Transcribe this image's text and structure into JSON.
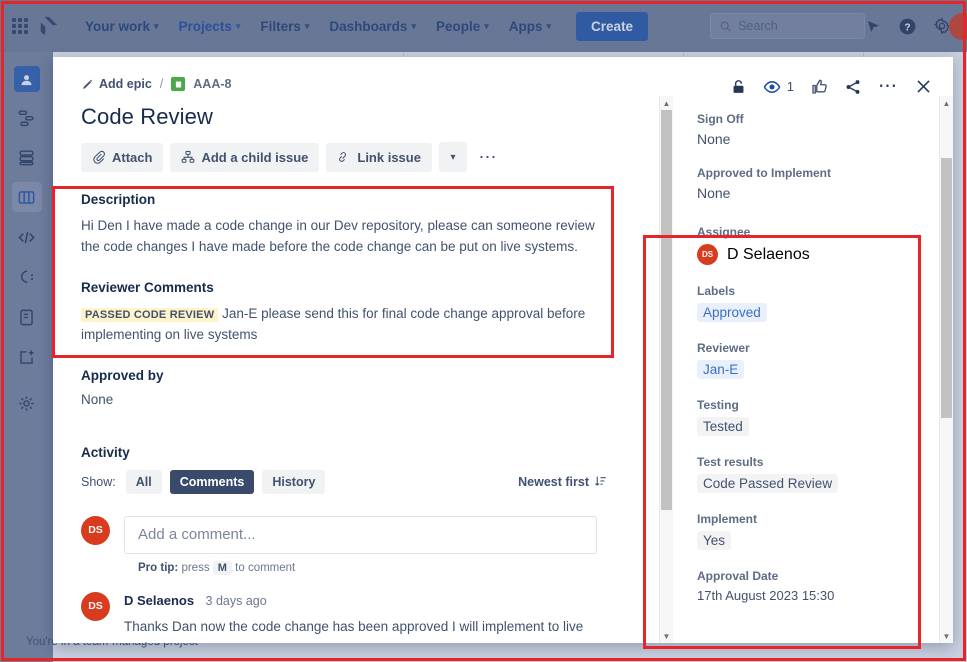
{
  "topnav": {
    "apps_grid_icon": "grid-icon",
    "product_logo_icon": "jira-logo-icon",
    "items": [
      {
        "label": "Your work",
        "has_caret": true,
        "active": false
      },
      {
        "label": "Projects",
        "has_caret": true,
        "active": true
      },
      {
        "label": "Filters",
        "has_caret": true,
        "active": false
      },
      {
        "label": "Dashboards",
        "has_caret": true,
        "active": false
      },
      {
        "label": "People",
        "has_caret": true,
        "active": false
      },
      {
        "label": "Apps",
        "has_caret": true,
        "active": false
      }
    ],
    "create_label": "Create",
    "search_placeholder": "Search",
    "search_value": "",
    "right_icons": [
      "notifications-icon",
      "help-icon",
      "settings-icon"
    ],
    "avatar_color": "#d93b1e"
  },
  "leftrail": {
    "project_avatar_icon": "project-avatar-icon",
    "items": [
      {
        "icon": "roadmap-icon",
        "selected": false
      },
      {
        "icon": "backlog-icon",
        "selected": false
      },
      {
        "icon": "board-icon",
        "selected": true
      },
      {
        "icon": "code-icon",
        "selected": false
      },
      {
        "icon": "releases-icon",
        "selected": false
      },
      {
        "icon": "pages-icon",
        "selected": false
      },
      {
        "icon": "add-item-icon",
        "selected": false
      },
      {
        "icon": "project-settings-icon",
        "selected": false
      }
    ],
    "footer_note": "You're in a team-managed project"
  },
  "modal": {
    "breadcrumb": {
      "epic_label": "Add epic",
      "epic_icon": "pencil-icon",
      "separator": "/",
      "issue_type_icon": "story-icon",
      "issue_key": "AAA-8"
    },
    "head_actions": {
      "lock_icon": "unlock-icon",
      "watch_icon": "watch-eye-icon",
      "watch_count": "1",
      "vote_icon": "thumbs-up-icon",
      "share_icon": "share-icon",
      "more_icon": "more-actions-icon",
      "close_icon": "close-icon"
    },
    "title": "Code Review",
    "toolbar": {
      "attach_label": "Attach",
      "attach_icon": "paperclip-icon",
      "child_issue_label": "Add a child issue",
      "child_issue_icon": "child-issue-icon",
      "link_issue_label": "Link issue",
      "link_issue_icon": "link-icon",
      "more_caret_icon": "chevron-down-icon",
      "more_actions_icon": "more-actions-icon"
    },
    "description": {
      "heading": "Description",
      "text": "Hi Den I have made a code change in our Dev repository, please can someone review the code changes I have made before the code change can be put on live systems."
    },
    "reviewer_comments": {
      "heading": "Reviewer Comments",
      "highlight": "PASSED CODE REVIEW",
      "text": "Jan-E please send this for final code change approval before implementing on live systems"
    },
    "approved_by": {
      "heading": "Approved by",
      "value": "None"
    },
    "activity": {
      "heading": "Activity",
      "show_label": "Show:",
      "filters": [
        {
          "label": "All",
          "selected": false
        },
        {
          "label": "Comments",
          "selected": true
        },
        {
          "label": "History",
          "selected": false
        }
      ],
      "sort_label": "Newest first",
      "sort_icon": "sort-descending-icon"
    },
    "comment_box": {
      "avatar_initials": "DS",
      "placeholder": "Add a comment...",
      "pro_tip_prefix": "Pro tip:",
      "pro_tip_mid": "press",
      "pro_tip_key": "M",
      "pro_tip_suffix": "to comment"
    },
    "comments": [
      {
        "avatar_initials": "DS",
        "author": "D Selaenos",
        "time": "3 days ago",
        "body": "Thanks Dan now the code change has been approved I will implement to live systems."
      }
    ],
    "details": [
      {
        "name": "sign-off",
        "label": "Sign Off",
        "value": "None",
        "style": "plain"
      },
      {
        "name": "approved-to-implement",
        "label": "Approved to Implement",
        "value": "None",
        "style": "plain"
      },
      {
        "name": "assignee",
        "label": "Assignee",
        "value": "D Selaenos",
        "style": "user",
        "avatar_initials": "DS"
      },
      {
        "name": "labels",
        "label": "Labels",
        "value": "Approved",
        "style": "chip-blue"
      },
      {
        "name": "reviewer",
        "label": "Reviewer",
        "value": "Jan-E",
        "style": "chip-blue"
      },
      {
        "name": "testing",
        "label": "Testing",
        "value": "Tested",
        "style": "chip-grey"
      },
      {
        "name": "test-results",
        "label": "Test results",
        "value": "Code Passed Review",
        "style": "chip-grey"
      },
      {
        "name": "implement",
        "label": "Implement",
        "value": "Yes",
        "style": "chip-grey"
      },
      {
        "name": "approval-date",
        "label": "Approval Date",
        "value": "17th August 2023 15:30",
        "style": "date"
      }
    ]
  },
  "annotations": {
    "colors": {
      "highlight_red": "#e8232a",
      "accent_blue": "#2357a6",
      "avatar_red": "#d93b1e",
      "label_blue": "#3a6fc4"
    },
    "boxes": [
      "outer-screen-highlight",
      "description-section-highlight",
      "details-panel-highlight"
    ]
  }
}
